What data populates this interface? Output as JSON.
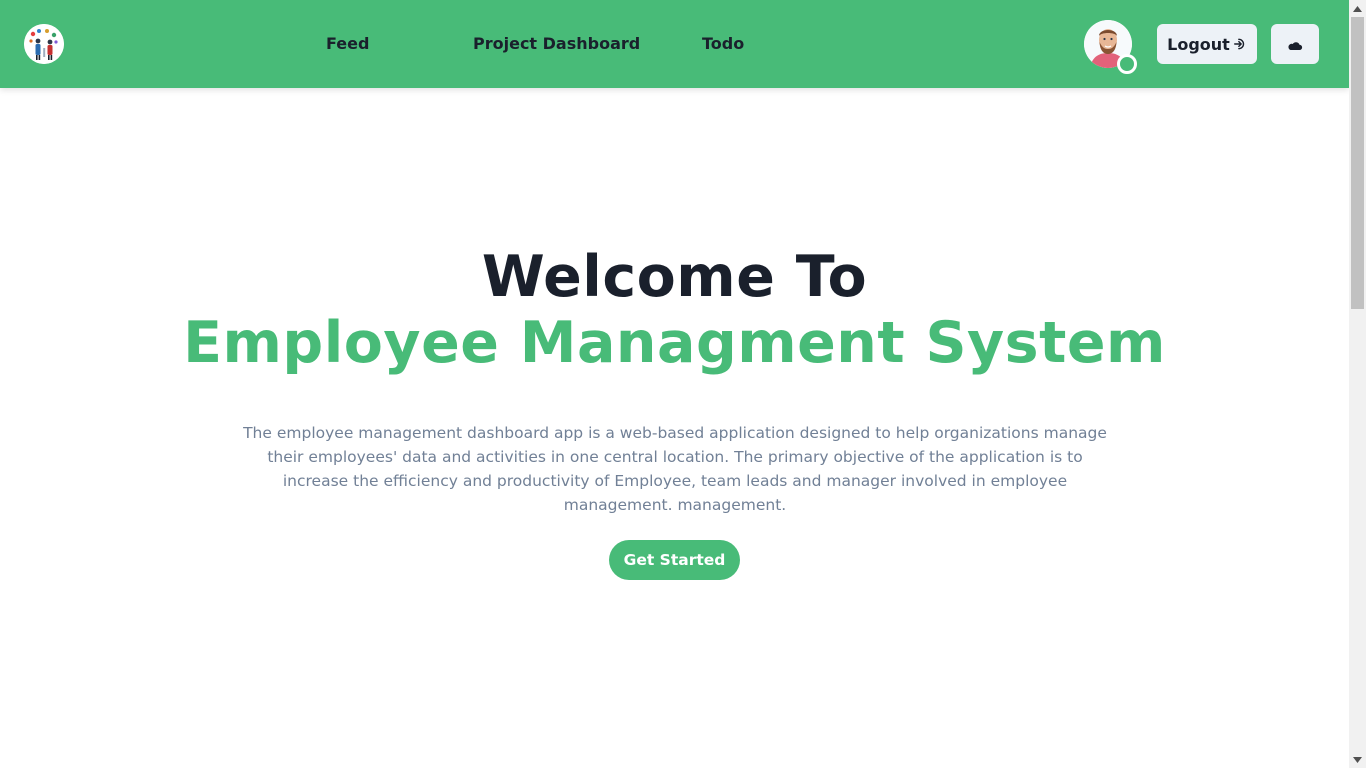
{
  "colors": {
    "brand": "#48bb78",
    "heading": "#1a202c",
    "body_text": "#718096",
    "button_light": "#edf2f7"
  },
  "navbar": {
    "logo_icon": "team-people-logo-icon",
    "links": [
      {
        "label": "Feed"
      },
      {
        "label": "Project Dashboard"
      },
      {
        "label": "Todo"
      }
    ],
    "avatar_icon": "user-avatar-icon",
    "logout_label": "Logout",
    "logout_icon": "logout-icon",
    "theme_icon": "moon-cloud-icon"
  },
  "hero": {
    "title_line1": "Welcome To",
    "title_line2": "Employee Managment System",
    "description": "The employee management dashboard app is a web-based application designed to help organizations manage their employees' data and activities in one central location. The primary objective of the application is to increase the efficiency and productivity of Employee, team leads and manager involved in employee management. management.",
    "cta_label": "Get Started"
  }
}
